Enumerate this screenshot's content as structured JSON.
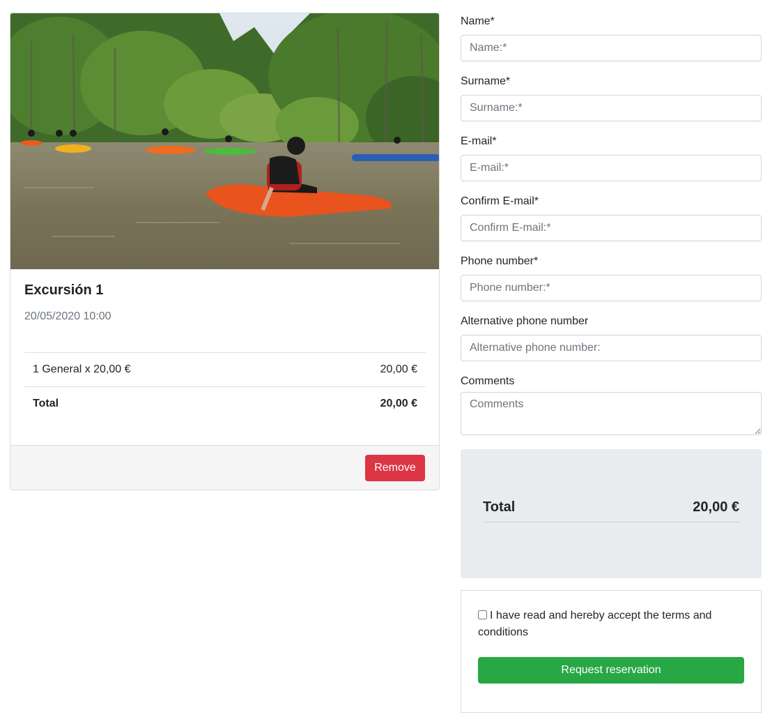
{
  "excursion": {
    "image_alt": "Kayakers paddling on a river",
    "title": "Excursión 1",
    "date": "20/05/2020 10:00",
    "lines": [
      {
        "label": "1 General x 20,00 €",
        "amount": "20,00 €"
      }
    ],
    "total_label": "Total",
    "total_amount": "20,00 €",
    "remove_label": "Remove"
  },
  "form": {
    "name": {
      "label": "Name*",
      "placeholder": "Name:*",
      "value": ""
    },
    "surname": {
      "label": "Surname*",
      "placeholder": "Surname:*",
      "value": ""
    },
    "email": {
      "label": "E-mail*",
      "placeholder": "E-mail:*",
      "value": ""
    },
    "confirm_email": {
      "label": "Confirm E-mail*",
      "placeholder": "Confirm E-mail:*",
      "value": ""
    },
    "phone": {
      "label": "Phone number*",
      "placeholder": "Phone number:*",
      "value": ""
    },
    "alt_phone": {
      "label": "Alternative phone number",
      "placeholder": "Alternative phone number:",
      "value": ""
    },
    "comments": {
      "label": "Comments",
      "placeholder": "Comments",
      "value": ""
    }
  },
  "summary": {
    "total_label": "Total",
    "total_amount": "20,00 €"
  },
  "terms": {
    "checkbox_checked": false,
    "text": "I have read and hereby accept the terms and conditions",
    "submit_label": "Request reservation"
  },
  "colors": {
    "danger": "#dc3545",
    "success": "#28a745",
    "summary_bg": "#e9ecef"
  }
}
